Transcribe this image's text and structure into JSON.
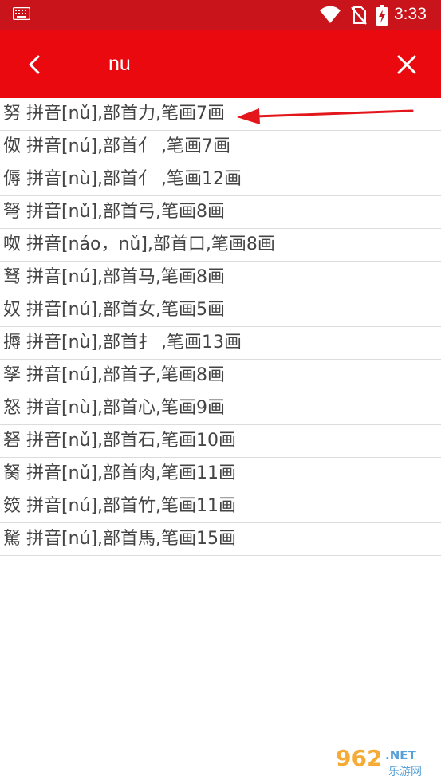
{
  "status_bar": {
    "time": "3:33",
    "icons": [
      "keyboard-icon",
      "wifi-icon",
      "no-sim-icon",
      "battery-charging-icon"
    ]
  },
  "header": {
    "query": "nu",
    "back_icon": "back-chevron-icon",
    "clear_icon": "close-icon",
    "background_color": "#e9090f"
  },
  "results": [
    "努 拼音[nǔ],部首力,笔画7画",
    "伮 拼音[nú],部首亻 ,笔画7画",
    "傉 拼音[nù],部首亻 ,笔画12画",
    "弩 拼音[nǔ],部首弓,笔画8画",
    "呶 拼音[náo，nǔ],部首口,笔画8画",
    "驽 拼音[nú],部首马,笔画8画",
    "奴 拼音[nú],部首女,笔画5画",
    "搙 拼音[nù],部首扌 ,笔画13画",
    "孥 拼音[nú],部首子,笔画8画",
    "怒 拼音[nù],部首心,笔画9画",
    "砮 拼音[nǔ],部首石,笔画10画",
    "胬 拼音[nǔ],部首肉,笔画11画",
    "笯 拼音[nú],部首竹,笔画11画",
    "駑 拼音[nú],部首馬,笔画15画"
  ],
  "annotation": {
    "arrow_color": "#e3161c"
  },
  "watermark": {
    "brand": "962.NET",
    "sub": "乐游网"
  }
}
